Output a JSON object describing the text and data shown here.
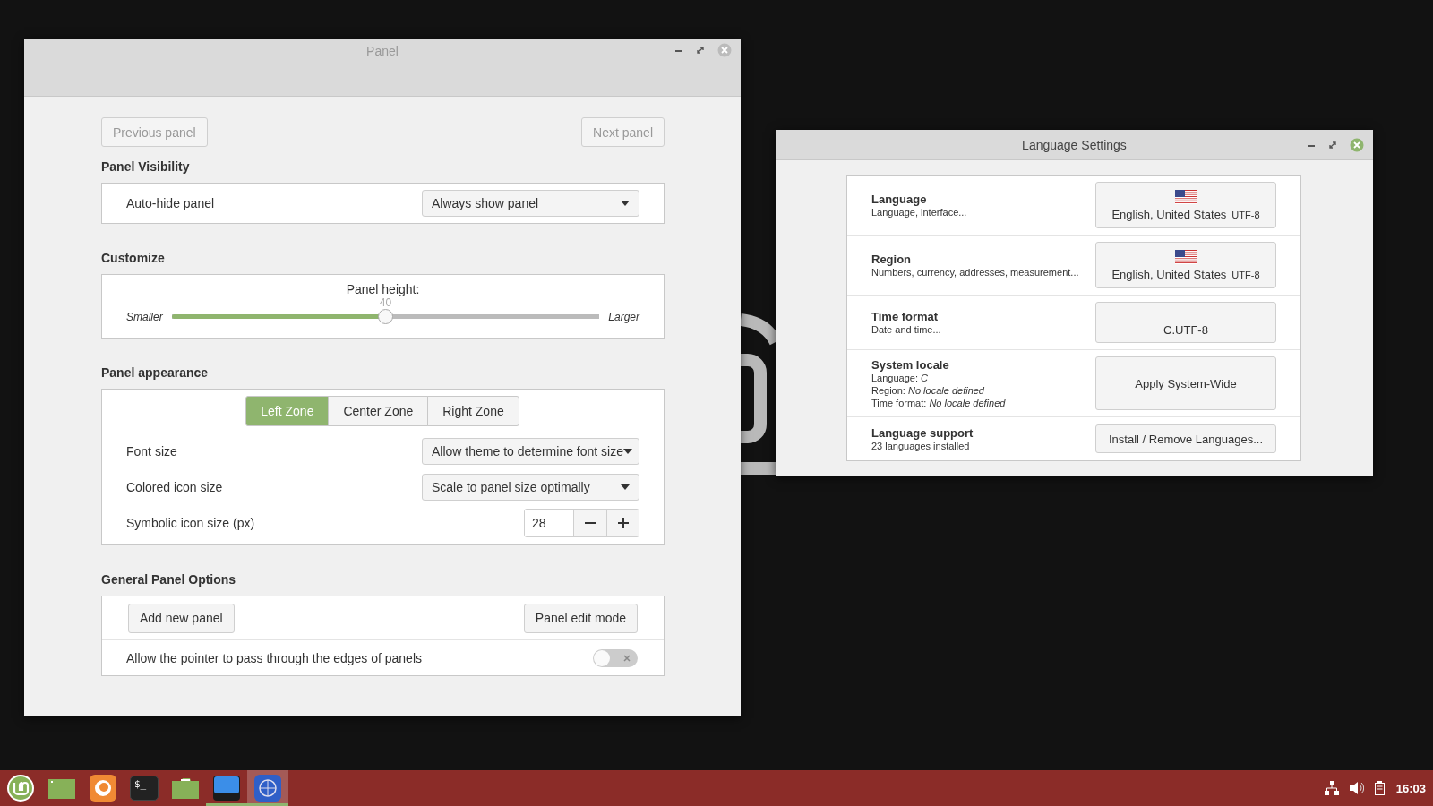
{
  "panel_window": {
    "title": "Panel",
    "nav_buttons": [
      {
        "label": "Previous panel",
        "disabled": true
      },
      {
        "label": "Next panel",
        "disabled": true
      }
    ],
    "visibility": {
      "heading": "Panel Visibility",
      "label": "Auto-hide panel",
      "value": "Always show panel"
    },
    "customize": {
      "heading": "Customize",
      "label": "Panel height:",
      "value": "40",
      "min_label": "Smaller",
      "max_label": "Larger",
      "level": 0.5
    },
    "appearance": {
      "heading": "Panel appearance",
      "tabs": [
        {
          "label": "Left Zone",
          "selected": true
        },
        {
          "label": "Center Zone",
          "selected": false
        },
        {
          "label": "Right Zone",
          "selected": false
        }
      ],
      "rows": [
        {
          "kind": "dropdown",
          "label": "Font size",
          "value": "Allow theme to determine font size"
        },
        {
          "kind": "dropdown",
          "label": "Colored icon size",
          "value": "Scale to panel size optimally"
        },
        {
          "kind": "spin",
          "label": "Symbolic icon size (px)",
          "value": "28"
        }
      ]
    },
    "general": {
      "heading": "General Panel Options",
      "buttons": [
        "Add new panel",
        "Panel edit mode"
      ],
      "toggle": {
        "label": "Allow the pointer to pass through the edges of panels",
        "on": false
      }
    }
  },
  "language_window": {
    "title": "Language Settings",
    "rows": [
      {
        "title": "Language",
        "lines": [
          "Language, interface..."
        ],
        "kind": "flag",
        "value": "English, United States",
        "encoding": "UTF-8"
      },
      {
        "title": "Region",
        "lines": [
          "Numbers, currency, addresses, measurement..."
        ],
        "kind": "flag",
        "value": "English, United States",
        "encoding": "UTF-8"
      },
      {
        "title": "Time format",
        "lines": [
          "Date and time..."
        ],
        "kind": "plain",
        "value": "C.UTF-8"
      },
      {
        "title": "System locale",
        "lines": [
          "Language: *C*",
          "Region: *No locale defined*",
          "Time format: *No locale defined*"
        ],
        "kind": "action",
        "value": "Apply System-Wide"
      },
      {
        "title": "Language support",
        "lines": [
          "23 languages installed"
        ],
        "kind": "action",
        "value": "Install / Remove Languages..."
      }
    ]
  },
  "taskbar": {
    "items": [
      {
        "kind": "menu",
        "running": false,
        "selected": false
      },
      {
        "kind": "desktop",
        "running": false,
        "selected": false
      },
      {
        "kind": "browser",
        "running": false,
        "selected": false
      },
      {
        "kind": "terminal",
        "glyph": "$_",
        "running": false,
        "selected": false
      },
      {
        "kind": "files",
        "running": false,
        "selected": false
      },
      {
        "kind": "settings",
        "running": true,
        "selected": false
      },
      {
        "kind": "language",
        "running": true,
        "selected": true
      }
    ],
    "clock": "16:03"
  }
}
